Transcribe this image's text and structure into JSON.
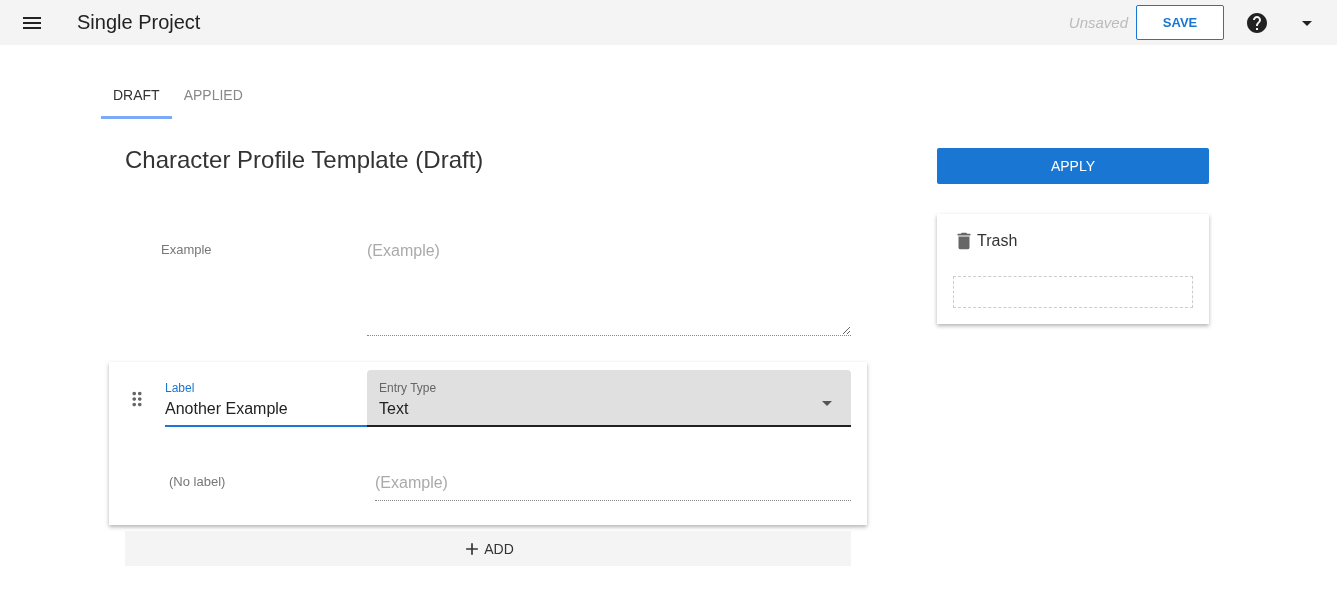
{
  "app_bar": {
    "title": "Single Project",
    "save_status": "Unsaved",
    "save_button": "SAVE"
  },
  "tabs": [
    {
      "label": "DRAFT",
      "selected": true
    },
    {
      "label": "APPLIED",
      "selected": false
    }
  ],
  "template": {
    "title": "Character Profile Template (Draft)",
    "entries": [
      {
        "kind": "view",
        "label": "Example",
        "placeholder": "(Example)",
        "multiline": true
      },
      {
        "kind": "edit",
        "label_field": {
          "label": "Label",
          "value": "Another Example"
        },
        "type_field": {
          "label": "Entry Type",
          "value": "Text"
        },
        "preview_label": "(No label)",
        "placeholder": "(Example)",
        "multiline": false
      }
    ],
    "add_button": "ADD"
  },
  "apply_button": "APPLY",
  "trash": {
    "title": "Trash"
  }
}
